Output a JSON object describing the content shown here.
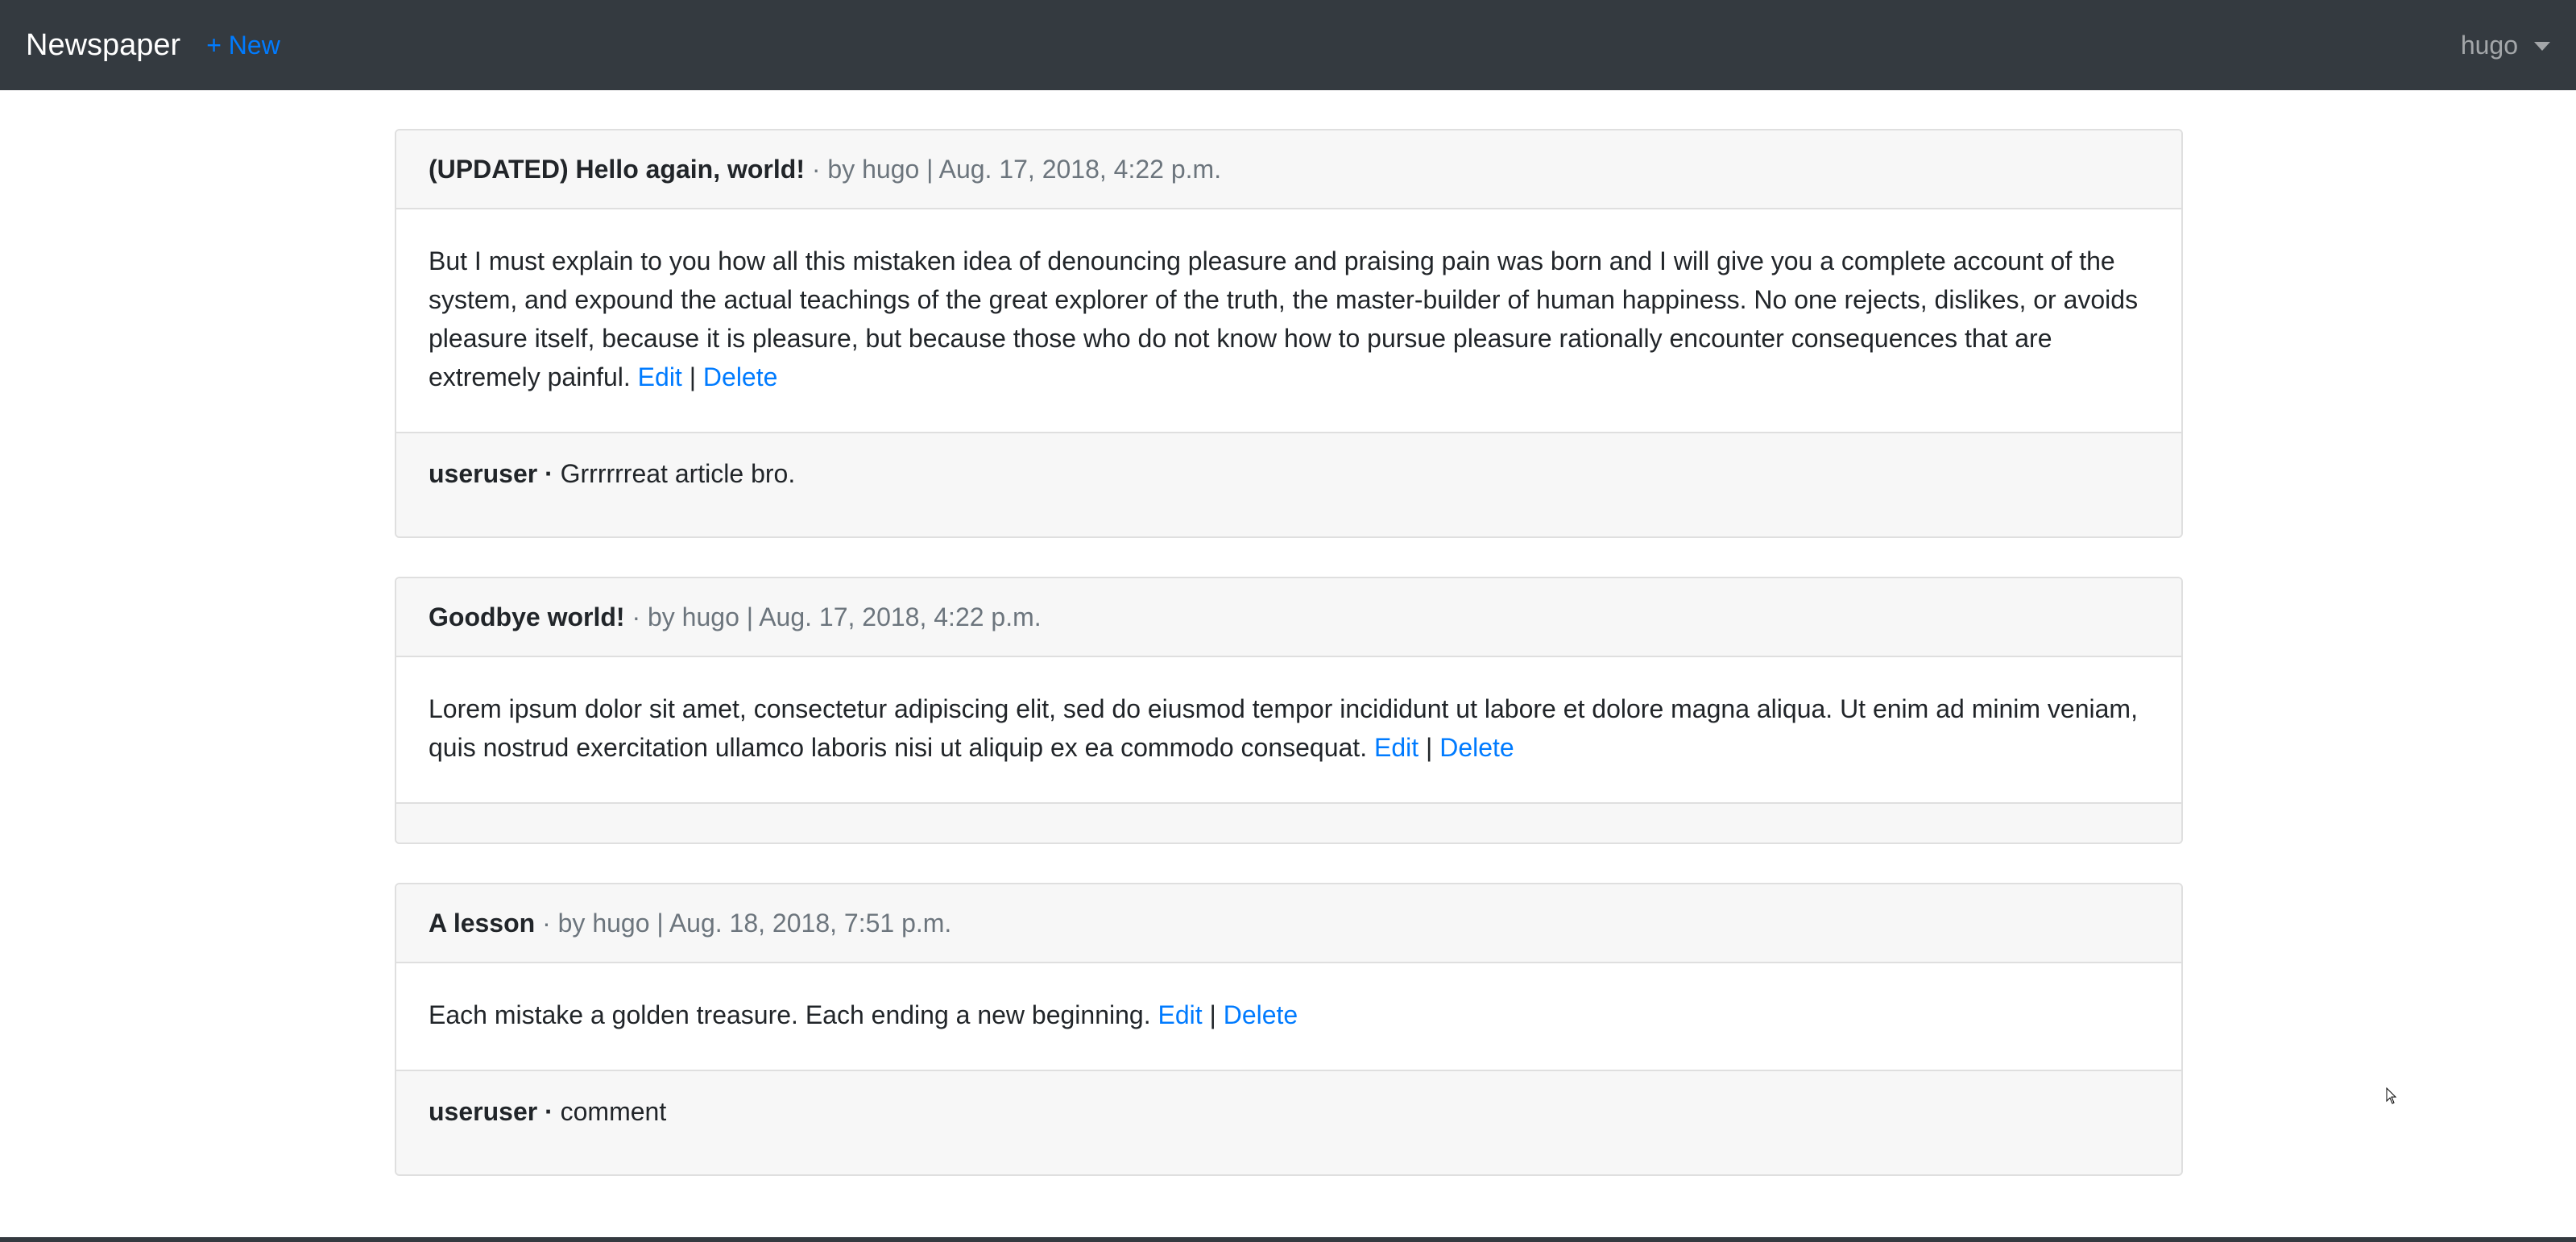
{
  "navbar": {
    "brand": "Newspaper",
    "new_link": "+ New",
    "user": "hugo"
  },
  "articles": [
    {
      "title": "(UPDATED) Hello again, world!",
      "meta": " · by hugo | Aug. 17, 2018, 4:22 p.m.",
      "body": "But I must explain to you how all this mistaken idea of denouncing pleasure and praising pain was born and I will give you a complete account of the system, and expound the actual teachings of the great explorer of the truth, the master-builder of human happiness. No one rejects, dislikes, or avoids pleasure itself, because it is pleasure, but because those who do not know how to pursue pleasure rationally encounter consequences that are extremely painful.",
      "edit": "Edit",
      "separator": "|",
      "delete": "Delete",
      "comment_user": "useruser ·",
      "comment_text": "Grrrrrreat article bro."
    },
    {
      "title": "Goodbye world!",
      "meta": " · by hugo | Aug. 17, 2018, 4:22 p.m.",
      "body": "Lorem ipsum dolor sit amet, consectetur adipiscing elit, sed do eiusmod tempor incididunt ut labore et dolore magna aliqua. Ut enim ad minim veniam, quis nostrud exercitation ullamco laboris nisi ut aliquip ex ea commodo consequat.",
      "edit": "Edit",
      "separator": "|",
      "delete": "Delete"
    },
    {
      "title": "A lesson",
      "meta": " · by hugo | Aug. 18, 2018, 7:51 p.m.",
      "body": "Each mistake a golden treasure. Each ending a new beginning.",
      "edit": "Edit",
      "separator": "|",
      "delete": "Delete",
      "comment_user": "useruser ·",
      "comment_text": "comment"
    }
  ],
  "colors": {
    "navbar_bg": "#343a40",
    "link": "#007bff",
    "meta_text": "#6c757d",
    "card_header_bg": "#f7f7f7"
  }
}
